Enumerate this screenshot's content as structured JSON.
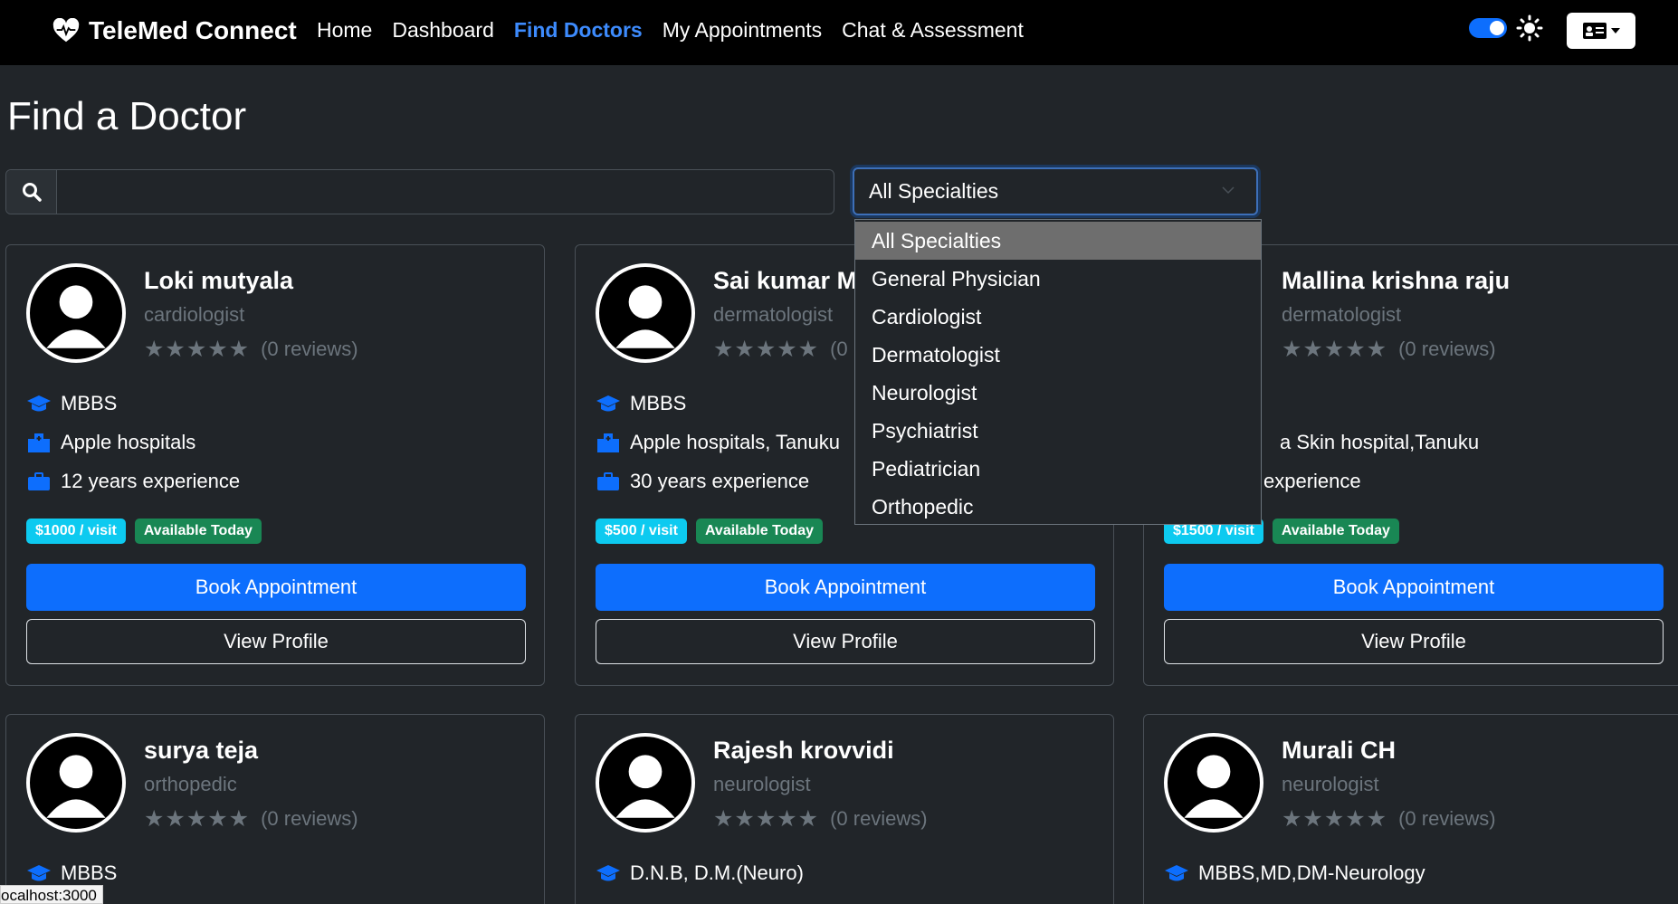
{
  "brand": {
    "name": "TeleMed Connect"
  },
  "nav": [
    {
      "label": "Home",
      "active": false
    },
    {
      "label": "Dashboard",
      "active": false
    },
    {
      "label": "Find Doctors",
      "active": true
    },
    {
      "label": "My Appointments",
      "active": false
    },
    {
      "label": "Chat & Assessment",
      "active": false
    }
  ],
  "page": {
    "title": "Find a Doctor"
  },
  "search": {
    "value": "",
    "placeholder": ""
  },
  "specialty_select": {
    "selected": "All Specialties",
    "options": [
      "All Specialties",
      "General Physician",
      "Cardiologist",
      "Dermatologist",
      "Neurologist",
      "Psychiatrist",
      "Pediatrician",
      "Orthopedic"
    ]
  },
  "doctors": [
    {
      "name": "Loki mutyala",
      "specialty": "cardiologist",
      "reviews": "(0 reviews)",
      "qualification": "MBBS",
      "hospital": "Apple hospitals",
      "experience": "12 years experience",
      "fee": "$1000 / visit",
      "availability": "Available Today",
      "book_label": "Book Appointment",
      "view_label": "View Profile"
    },
    {
      "name": "Sai kumar M",
      "specialty": "dermatologist",
      "reviews": "(0",
      "qualification": "MBBS",
      "hospital": "Apple hospitals, Tanuku",
      "experience": "30 years experience",
      "fee": "$500 / visit",
      "availability": "Available Today",
      "book_label": "Book Appointment",
      "view_label": "View Profile"
    },
    {
      "name": "Mallina krishna raju",
      "specialty": "dermatologist",
      "reviews": "(0 reviews)",
      "qualification": "",
      "hospital": "a Skin hospital,Tanuku",
      "experience": "experience",
      "fee": "$1500 / visit",
      "availability": "Available Today",
      "book_label": "Book Appointment",
      "view_label": "View Profile"
    },
    {
      "name": "surya teja",
      "specialty": "orthopedic",
      "reviews": "(0 reviews)",
      "qualification": "MBBS"
    },
    {
      "name": "Rajesh krovvidi",
      "specialty": "neurologist",
      "reviews": "(0 reviews)",
      "qualification": "D.N.B, D.M.(Neuro)"
    },
    {
      "name": "Murali CH",
      "specialty": "neurologist",
      "reviews": "(0 reviews)",
      "qualification": "MBBS,MD,DM-Neurology"
    }
  ],
  "status_bar": {
    "url": "ocalhost:3000"
  },
  "colors": {
    "accent": "#0d6efd",
    "fee_badge": "#0dcaf0",
    "available_badge": "#198754",
    "background": "#212529"
  },
  "icons": [
    "heart-pulse-icon",
    "sun-icon",
    "id-card-icon",
    "search-icon",
    "graduation-cap-icon",
    "hospital-icon",
    "briefcase-icon",
    "star-icon",
    "user-avatar-icon"
  ]
}
